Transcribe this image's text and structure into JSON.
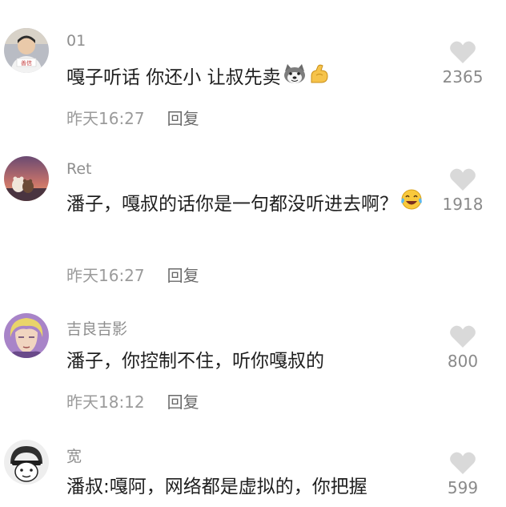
{
  "comments": [
    {
      "username": "01",
      "avatar_icon": "avatar-person-icon",
      "avatar_badge": "善信",
      "text": "嘎子听话 你还小 让叔先卖",
      "emojis": [
        "husky-emoji-icon",
        "flex-arm-emoji-icon"
      ],
      "time": "昨天16:27",
      "reply": "回复",
      "likes": "2365"
    },
    {
      "username": "Ret",
      "avatar_icon": "avatar-bear-sunset-icon",
      "text": "潘子，嘎叔的话你是一句都没听进去啊？",
      "emojis": [
        "laughing-tears-emoji-icon"
      ],
      "time": "昨天16:27",
      "reply": "回复",
      "likes": "1918"
    },
    {
      "username": "吉良吉影",
      "avatar_icon": "avatar-anime-character-icon",
      "text": "潘子，你控制不住，听你嘎叔的",
      "emojis": [],
      "time": "昨天18:12",
      "reply": "回复",
      "likes": "800"
    },
    {
      "username": "宽",
      "avatar_icon": "avatar-helmet-cartoon-icon",
      "text": "潘叔:嘎阿，网络都是虚拟的，你把握",
      "emojis": [],
      "time": "",
      "reply": "",
      "likes": "599"
    }
  ],
  "colors": {
    "like_heart": "#d9d9d9",
    "username": "#8e8e8e",
    "meta": "#9b9b9b"
  }
}
